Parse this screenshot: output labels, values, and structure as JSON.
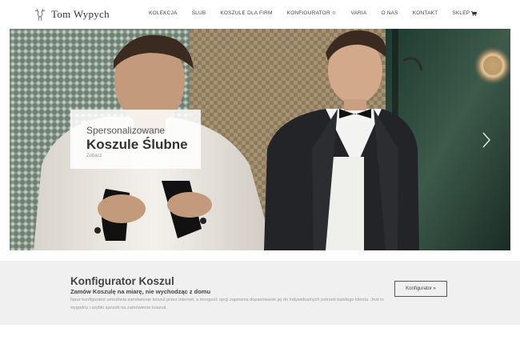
{
  "brand": {
    "name": "Tom Wypych"
  },
  "nav": {
    "items": [
      {
        "label": "KOLEKCJA"
      },
      {
        "label": "ŚLUB"
      },
      {
        "label": "KOSZULE DLA FIRM"
      },
      {
        "label": "KONFIGURATOR",
        "icon": "gear-icon"
      },
      {
        "label": "VARIA"
      },
      {
        "label": "O NAS"
      },
      {
        "label": "KONTAKT"
      },
      {
        "label": "SKLEP",
        "icon": "cart-icon"
      }
    ]
  },
  "hero": {
    "subtitle": "Spersonalizowane",
    "title": "Koszule Ślubne",
    "link": "Zobacz"
  },
  "configurator": {
    "title": "Konfigurator Koszul",
    "subtitle": "Zamów Koszulę na miarę, nie wychodząc z domu",
    "description": "Nasz konfigurator umożliwia zamówienie koszul przez internet, a mnogość opcji zapewnia dopasowanie jej do indywidualnych potrzeb każdego klienta. Jest to wygodny i szybki sposób na zamówienie koszuli.",
    "button": "Konfigurator »"
  },
  "colors": {
    "band_bg": "#f0f0f0",
    "text_dark": "#444444",
    "text_muted": "#999999",
    "hero_dark_green": "#2f4a40"
  }
}
